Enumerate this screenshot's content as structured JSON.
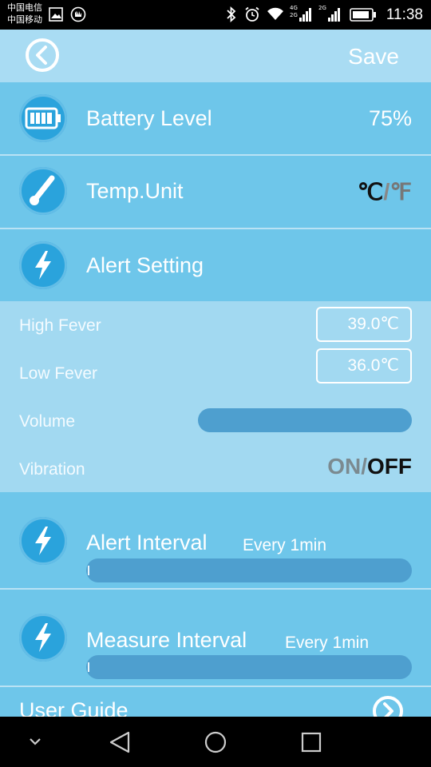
{
  "status_bar": {
    "carrier_1": "中国电信",
    "carrier_2": "中国移动",
    "net_1_top": "4G",
    "net_1_bottom": "2G",
    "net_2": "2G",
    "time": "11:38"
  },
  "header": {
    "back_icon": "back-circle-icon",
    "save_label": "Save"
  },
  "battery": {
    "label": "Battery Level",
    "value": "75%",
    "icon": "battery-icon"
  },
  "temp_unit": {
    "label": "Temp.Unit",
    "celsius": "℃",
    "separator": "/",
    "fahrenheit": "℉",
    "selected": "celsius",
    "icon": "thermometer-icon"
  },
  "alert_setting": {
    "label": "Alert Setting",
    "icon": "lightning-icon",
    "high_fever_label": "High Fever",
    "high_fever_value": "39.0℃",
    "low_fever_label": "Low Fever",
    "low_fever_value": "36.0℃",
    "volume_label": "Volume",
    "volume_level": 1.0,
    "vibration_label": "Vibration",
    "vibration_on": "ON",
    "vibration_separator": "/",
    "vibration_off": "OFF",
    "vibration_selected": "off"
  },
  "alert_interval": {
    "label": "Alert Interval",
    "value": "Every 1min",
    "level": 0.0,
    "icon": "lightning-icon"
  },
  "measure_interval": {
    "label": "Measure Interval",
    "value": "Every 1min",
    "level": 0.0,
    "icon": "lightning-icon"
  },
  "user_guide": {
    "label": "User Guide",
    "icon": "forward-circle-icon"
  },
  "nav_bar": {
    "items": [
      "collapse-icon",
      "back-triangle-icon",
      "home-circle-icon",
      "recents-square-icon"
    ]
  },
  "colors": {
    "background": "#6ec6ea",
    "header": "#a9dcf3",
    "panel": "#a2d9f1",
    "slider": "#4e9fcf",
    "icon_circle": "#2aa3dc"
  }
}
